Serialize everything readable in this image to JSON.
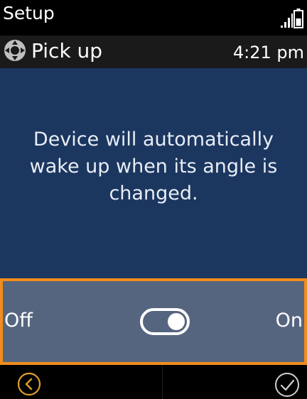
{
  "status_bar": {
    "app_label": "Setup",
    "signal_icon": "signal-icon",
    "battery_icon": "battery-icon"
  },
  "title_bar": {
    "icon": "pickup-motion-icon",
    "title": "Pick up",
    "clock": "4:21 pm"
  },
  "content": {
    "description": "Device will automatically wake up when its angle is changed."
  },
  "toggle": {
    "off_label": "Off",
    "on_label": "On",
    "state": "on"
  },
  "soft_keys": {
    "back_icon": "chevron-left-icon",
    "confirm_icon": "check-icon"
  },
  "colors": {
    "content_background": "#1b365f",
    "toggle_row_background": "#56657f",
    "focus_border": "#f28c1c",
    "soft_key_accent": "#e0a028"
  }
}
